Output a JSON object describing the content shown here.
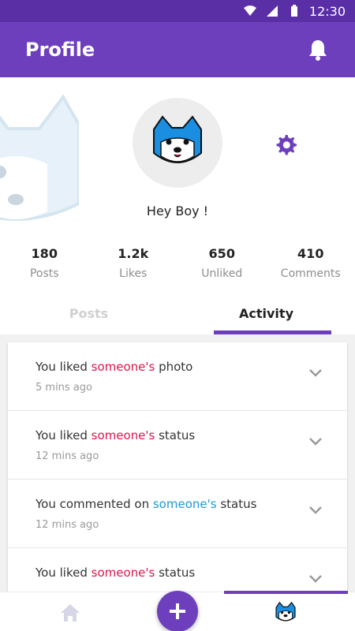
{
  "statusbar": {
    "time": "12:30"
  },
  "appbar": {
    "title": "Profile"
  },
  "profile": {
    "username": "Hey Boy !"
  },
  "stats": [
    {
      "value": "180",
      "label": "Posts"
    },
    {
      "value": "1.2k",
      "label": "Likes"
    },
    {
      "value": "650",
      "label": "Unliked"
    },
    {
      "value": "410",
      "label": "Comments"
    }
  ],
  "tabs": [
    {
      "label": "Posts"
    },
    {
      "label": "Activity"
    }
  ],
  "activity": [
    {
      "prefix": "You liked ",
      "who": "someone's",
      "suffix": " photo",
      "time": "5 mins ago"
    },
    {
      "prefix": "You liked ",
      "who": "someone's",
      "suffix": " status",
      "time": "12 mins ago"
    },
    {
      "prefix": "You commented on ",
      "who": "someone's",
      "suffix": " status",
      "time": "12 mins ago"
    },
    {
      "prefix": "You liked ",
      "who": "someone's",
      "suffix": " status",
      "time": ""
    }
  ],
  "colors": {
    "primary": "#6d3fbd",
    "statusbar": "#5a2fa6",
    "like_highlight": "#e0144c",
    "comment_highlight": "#1a9ad6"
  }
}
